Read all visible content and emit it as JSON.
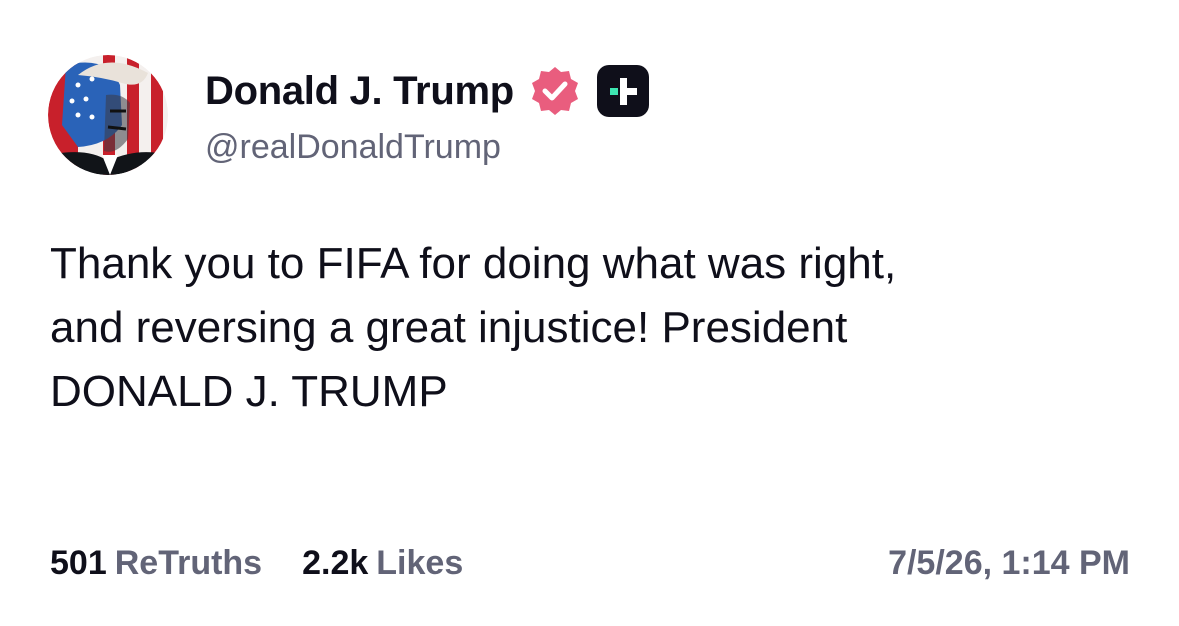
{
  "author": {
    "display_name": "Donald J. Trump",
    "handle": "@realDonaldTrump",
    "verified_icon": "verified-badge-icon",
    "badge_icon": "plus-badge-icon",
    "verified_color": "#e95d7e",
    "badge_color": "#0f0f1a",
    "badge_accent": "#3ee6b2"
  },
  "post": {
    "text": "Thank you to FIFA for doing what was right,\nand reversing a great injustice! President\nDONALD J. TRUMP"
  },
  "stats": {
    "retruths_count": "501",
    "retruths_label": "ReTruths",
    "likes_count": "2.2k",
    "likes_label": "Likes",
    "timestamp": "7/5/26, 1:14 PM"
  }
}
